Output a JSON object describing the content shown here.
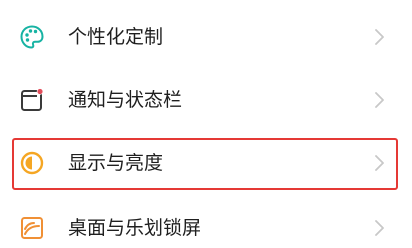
{
  "settings": {
    "items": [
      {
        "label": "个性化定制",
        "icon": "palette-icon"
      },
      {
        "label": "通知与状态栏",
        "icon": "notification-window-icon"
      },
      {
        "label": "显示与亮度",
        "icon": "brightness-icon"
      },
      {
        "label": "桌面与乐划锁屏",
        "icon": "wallpaper-icon"
      }
    ],
    "highlighted_index": 2
  },
  "colors": {
    "icon_teal": "#17b3a3",
    "icon_gray": "#3a3a3a",
    "notification_dot": "#e24c5a",
    "brightness_orange": "#f5a623",
    "wallpaper_orange": "#f09035",
    "highlight_red": "#e53935",
    "chevron_gray": "#c8c8c8",
    "text": "#1f1f1f"
  }
}
